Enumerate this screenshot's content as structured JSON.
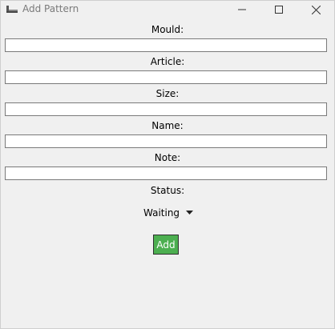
{
  "window": {
    "title": "Add Pattern"
  },
  "form": {
    "fields": [
      {
        "label": "Mould:",
        "value": ""
      },
      {
        "label": "Article:",
        "value": ""
      },
      {
        "label": "Size:",
        "value": ""
      },
      {
        "label": "Name:",
        "value": ""
      },
      {
        "label": "Note:",
        "value": ""
      }
    ],
    "status": {
      "label": "Status:",
      "selected": "Waiting"
    },
    "add_label": "Add"
  },
  "colors": {
    "add_button_bg": "#4caf50",
    "window_bg": "#f0f0f0"
  },
  "icons": {
    "app": "app-window-icon",
    "minimize": "minimize-icon",
    "maximize": "maximize-icon",
    "close": "close-icon",
    "dropdown": "triangle-down-icon"
  }
}
